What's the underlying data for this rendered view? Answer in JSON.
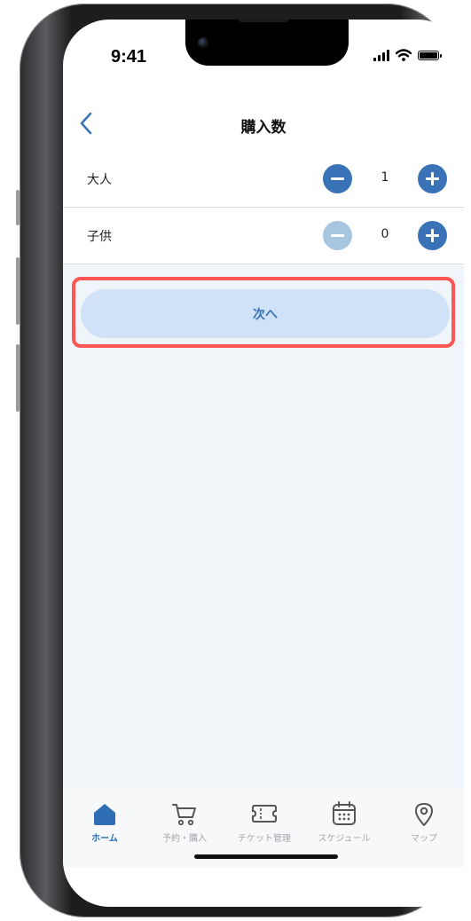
{
  "status_bar": {
    "time": "9:41"
  },
  "navbar": {
    "title": "購入数"
  },
  "rows": [
    {
      "label": "大人",
      "count": "1"
    },
    {
      "label": "子供",
      "count": "0"
    }
  ],
  "next_button": {
    "label": "次へ"
  },
  "tabbar": {
    "items": [
      {
        "label": "ホーム",
        "icon": "home-icon",
        "active": true
      },
      {
        "label": "予約・購入",
        "icon": "cart-icon",
        "active": false
      },
      {
        "label": "チケット管理",
        "icon": "ticket-icon",
        "active": false
      },
      {
        "label": "スケジュール",
        "icon": "calendar-icon",
        "active": false
      },
      {
        "label": "マップ",
        "icon": "map-pin-icon",
        "active": false
      }
    ]
  },
  "colors": {
    "accent": "#3a72b8",
    "disabled_button": "#a9c6e1",
    "next_button_bg": "#cfe2f8",
    "highlight_border": "#ff5555",
    "content_bg": "#f0f5fa",
    "inactive_tab": "#a3a7ad"
  }
}
